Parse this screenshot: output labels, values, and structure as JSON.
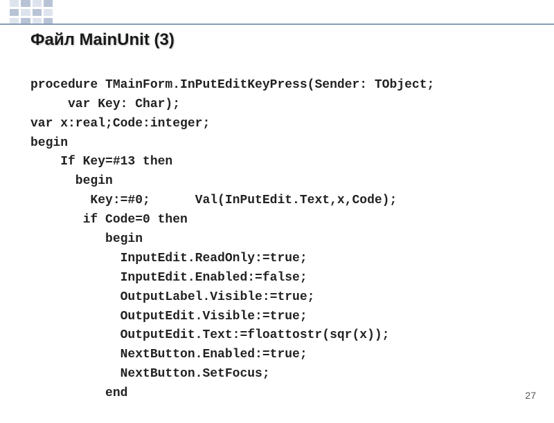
{
  "title": "Файл MainUnit (3)",
  "code_lines": [
    "procedure TMainForm.InPutEditKeyPress(Sender: TObject;",
    "     var Key: Char);",
    "var x:real;Code:integer;",
    "begin",
    "    If Key=#13 then",
    "      begin",
    "        Key:=#0;      Val(InPutEdit.Text,x,Code);",
    "       if Code=0 then",
    "          begin",
    "            InputEdit.ReadOnly:=true;",
    "            InputEdit.Enabled:=false;",
    "            OutputLabel.Visible:=true;",
    "            OutputEdit.Visible:=true;",
    "            OutputEdit.Text:=floattostr(sqr(x));",
    "            NextButton.Enabled:=true;",
    "            NextButton.SetFocus;",
    "          end"
  ],
  "page_number": "27"
}
